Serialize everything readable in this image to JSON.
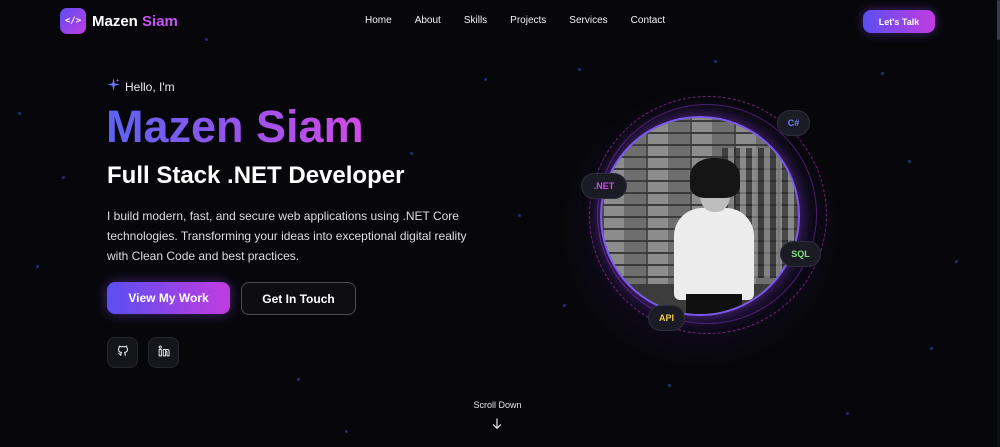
{
  "header": {
    "logo_first": "Mazen",
    "logo_second": "Siam",
    "logo_badge": "</>",
    "nav": [
      "Home",
      "About",
      "Skills",
      "Projects",
      "Services",
      "Contact"
    ],
    "cta": "Let's Talk"
  },
  "hero": {
    "greeting": "Hello, I'm",
    "name": "Mazen Siam",
    "role": "Full Stack .NET Developer",
    "description": "I build modern, fast, and secure web applications using .NET Core technologies. Transforming your ideas into exceptional digital reality with Clean Code and best practices.",
    "primary_button": "View My Work",
    "secondary_button": "Get In Touch",
    "social_icons": [
      "github-icon",
      "linkedin-icon"
    ]
  },
  "tech_badges": {
    "csharp": "C#",
    "dotnet": ".NET",
    "sql": "SQL",
    "api": "API"
  },
  "scroll": {
    "label": "Scroll Down"
  },
  "colors": {
    "background": "#07070b",
    "gradient_start": "#5b4ff2",
    "gradient_end": "#c13ce0",
    "csharp": "#6f86f5",
    "dotnet": "#d04ae6",
    "sql": "#7fe07f",
    "api": "#f0d040"
  }
}
